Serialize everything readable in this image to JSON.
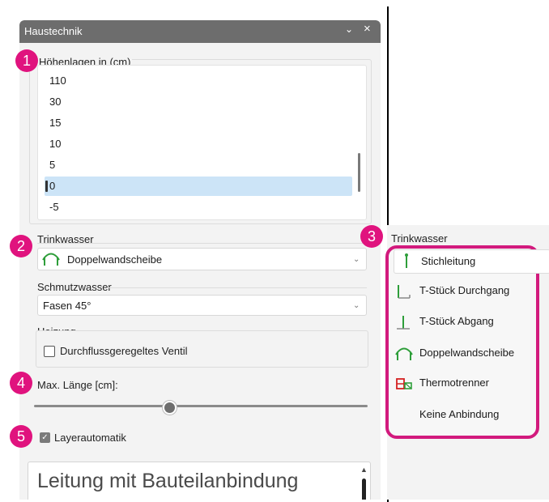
{
  "window": {
    "title": "Haustechnik",
    "chevron_icon": "chevron-down-icon",
    "close_icon": "close-icon"
  },
  "heights": {
    "label": "Höhenlagen in (cm)",
    "items": [
      "110",
      "30",
      "15",
      "10",
      "5",
      "0",
      "-5"
    ],
    "selected": "0"
  },
  "trinkwasser": {
    "label": "Trinkwasser",
    "value": "Doppelwandscheibe"
  },
  "schmutzwasser": {
    "label": "Schmutzwasser",
    "value": "Fasen 45°"
  },
  "heizung": {
    "label": "Heizung",
    "checkbox_label": "Durchflussgeregeltes Ventil",
    "checked": false
  },
  "max_length": {
    "label": "Max. Länge [cm]:",
    "slider_fraction": 0.39
  },
  "layerautomatik": {
    "label": "Layerautomatik",
    "checked": true
  },
  "text_box": {
    "value": "Leitung mit Bauteilanbindung"
  },
  "markers": [
    "1",
    "2",
    "3",
    "4",
    "5"
  ],
  "popup": {
    "label": "Trinkwasser",
    "selected": "Stichleitung",
    "options": [
      "T-Stück Durchgang",
      "T-Stück Abgang",
      "Doppelwandscheibe",
      "Thermotrenner",
      "Keine Anbindung"
    ]
  },
  "colors": {
    "accent": "#e0137e",
    "frame": "#d21a7d",
    "selection": "#cce4f7",
    "titlebar": "#6d6d6d",
    "icon_green": "#2e9e3a"
  }
}
